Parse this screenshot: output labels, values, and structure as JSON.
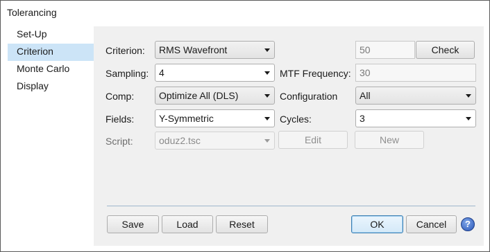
{
  "window": {
    "title": "Tolerancing"
  },
  "sidebar": {
    "items": [
      {
        "label": "Set-Up",
        "selected": false
      },
      {
        "label": "Criterion",
        "selected": true
      },
      {
        "label": "Monte Carlo",
        "selected": false
      },
      {
        "label": "Display",
        "selected": false
      }
    ]
  },
  "form": {
    "criterion": {
      "label": "Criterion:",
      "value": "RMS Wavefront"
    },
    "criterion_value": "50",
    "check_label": "Check",
    "sampling": {
      "label": "Sampling:",
      "value": "4"
    },
    "mtf_frequency": {
      "label": "MTF Frequency:",
      "value": "30"
    },
    "comp": {
      "label": "Comp:",
      "value": "Optimize All (DLS)"
    },
    "configuration": {
      "label": "Configuration",
      "value": "All"
    },
    "fields": {
      "label": "Fields:",
      "value": "Y-Symmetric"
    },
    "cycles": {
      "label": "Cycles:",
      "value": "3"
    },
    "script": {
      "label": "Script:",
      "value": "oduz2.tsc"
    },
    "edit_label": "Edit",
    "new_label": "New"
  },
  "footer": {
    "save_label": "Save",
    "load_label": "Load",
    "reset_label": "Reset",
    "ok_label": "OK",
    "cancel_label": "Cancel",
    "help_glyph": "?"
  },
  "colors": {
    "selection": "#cce4f7",
    "panel": "#f0f0f0",
    "help_blue": "#2a56b8"
  }
}
